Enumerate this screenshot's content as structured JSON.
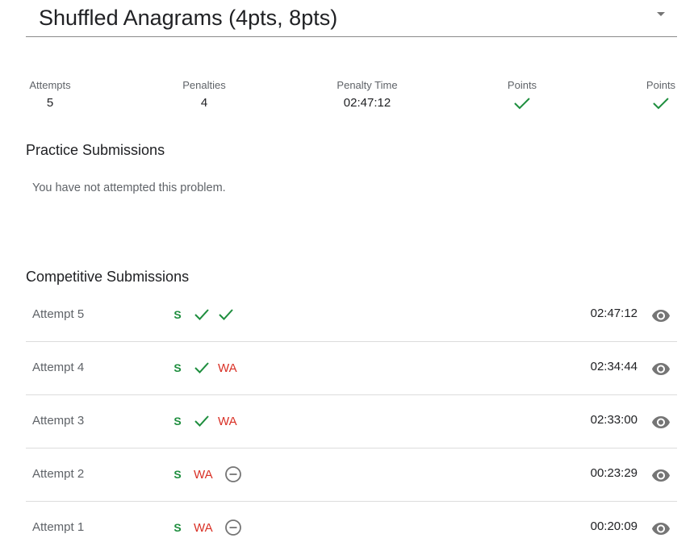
{
  "problem": {
    "title": "Shuffled Anagrams (4pts, 8pts)"
  },
  "stats": {
    "attempts_label": "Attempts",
    "attempts_value": "5",
    "penalties_label": "Penalties",
    "penalties_value": "4",
    "penalty_time_label": "Penalty Time",
    "penalty_time_value": "02:47:12",
    "points_label_1": "Points",
    "points_label_2": "Points",
    "points_status_1": "check-icon",
    "points_status_2": "check-icon"
  },
  "practice": {
    "title": "Practice Submissions",
    "empty_message": "You have not attempted this problem."
  },
  "competitive": {
    "title": "Competitive Submissions",
    "submissions": [
      {
        "label": "Attempt 5",
        "sample": "S",
        "set1": "check",
        "set2": "check",
        "time": "02:47:12"
      },
      {
        "label": "Attempt 4",
        "sample": "S",
        "set1": "check",
        "set2": "WA",
        "time": "02:34:44"
      },
      {
        "label": "Attempt 3",
        "sample": "S",
        "set1": "check",
        "set2": "WA",
        "time": "02:33:00"
      },
      {
        "label": "Attempt 2",
        "sample": "S",
        "set1": "WA",
        "set2": "skipped",
        "time": "00:23:29"
      },
      {
        "label": "Attempt 1",
        "sample": "S",
        "set1": "WA",
        "set2": "skipped",
        "time": "00:20:09"
      }
    ]
  },
  "colors": {
    "pass_green": "#1e8e3e",
    "fail_red": "#d93025",
    "muted_gray": "#5f6368",
    "icon_gray": "#757575"
  }
}
